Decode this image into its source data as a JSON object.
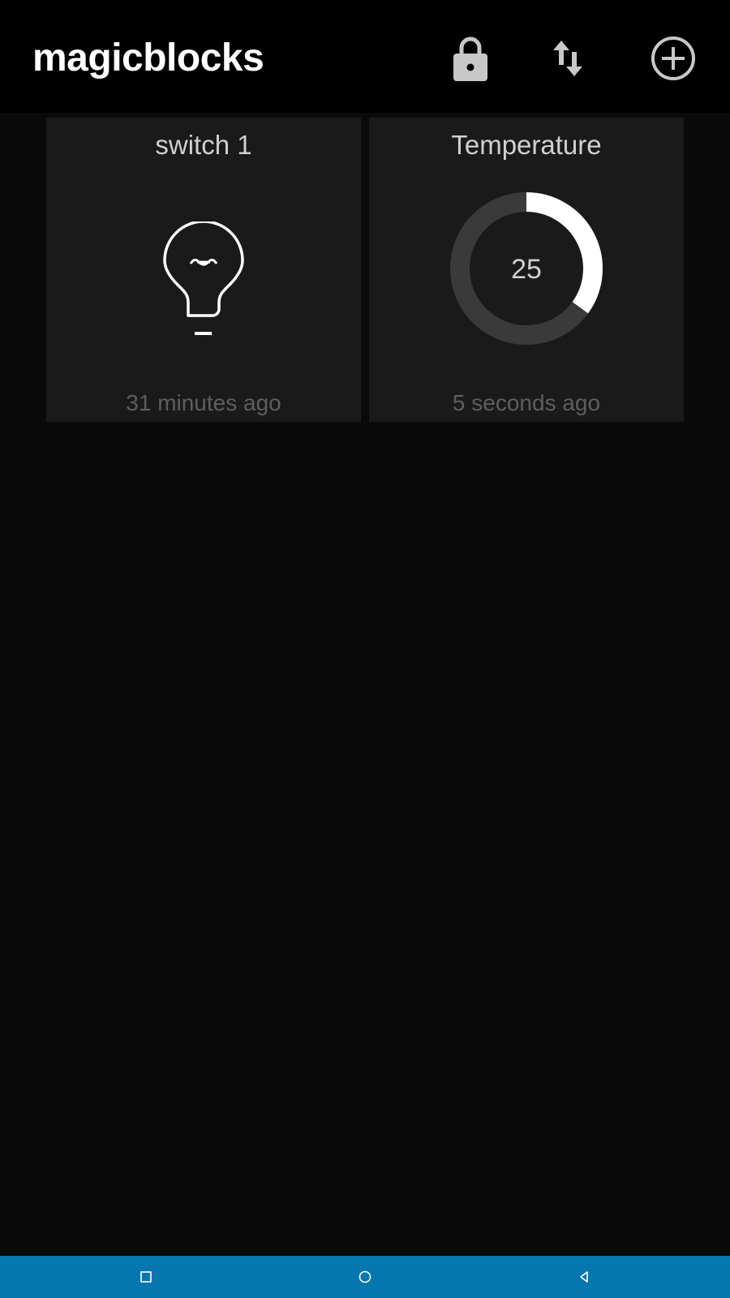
{
  "app": {
    "title": "magicblocks"
  },
  "toolbar": {
    "actions": [
      {
        "name": "lock",
        "icon": "lock-icon"
      },
      {
        "name": "sort",
        "icon": "swap-vertical-icon"
      },
      {
        "name": "add",
        "icon": "add-circle-icon"
      }
    ]
  },
  "tiles": [
    {
      "title": "switch 1",
      "icon": "lightbulb-icon",
      "state": "off",
      "updated": "31 minutes ago"
    },
    {
      "title": "Temperature",
      "value": "25",
      "gauge_fraction": 0.35,
      "updated": "5 seconds ago"
    }
  ],
  "navbar": {
    "buttons": [
      "recents-icon",
      "home-icon",
      "back-icon"
    ]
  },
  "colors": {
    "appbar": "#000000",
    "background": "#0a0a0a",
    "tile": "#1a1a1a",
    "gauge_track": "#3a3a3a",
    "gauge_fill": "#ffffff",
    "navbar": "#0777b0"
  }
}
